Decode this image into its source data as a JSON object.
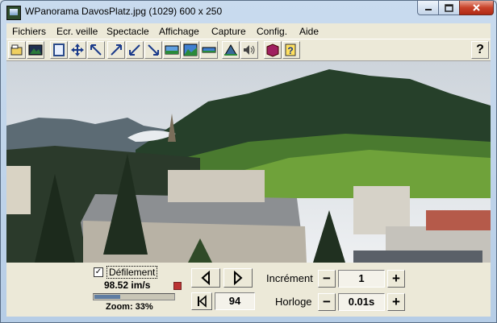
{
  "window": {
    "title": "WPanorama  DavosPlatz.jpg  (1029) 600 x 250"
  },
  "menu": [
    "Fichiers",
    "Ecr. veille",
    "Spectacle",
    "Affichage",
    "Capture",
    "Config.",
    "Aide"
  ],
  "toolbar": {
    "icons": [
      "open-file-icon",
      "picture-icon",
      "frame-icon",
      "move-arrows-icon",
      "arrow-up-left-icon",
      "arrow-up-right-icon",
      "arrow-down-left-icon",
      "arrow-down-right-icon",
      "panorama-image-icon",
      "landscape-icon",
      "narrow-panorama-icon",
      "mountain-icon",
      "speaker-icon",
      "book-icon",
      "help-doc-icon"
    ],
    "help_label": "?"
  },
  "controls": {
    "scroll_label": "Défilement",
    "scroll_checked": true,
    "rate": "98.52 im/s",
    "zoom_label": "Zoom: 33%",
    "zoom_value": 0.33,
    "frame": "94",
    "increment_label": "Incrément",
    "increment_value": "1",
    "clock_label": "Horloge",
    "clock_value": "0.01s",
    "minus": "−",
    "plus": "+",
    "check_mark": "✓"
  },
  "colors": {
    "titlebar": "#c9dbee",
    "close_button": "#c8422a",
    "client": "#ece9d8"
  }
}
